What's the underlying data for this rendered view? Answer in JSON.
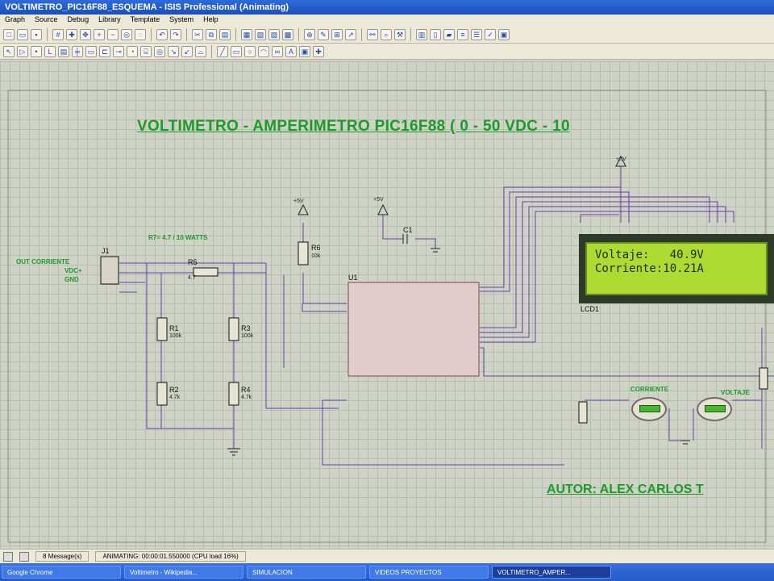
{
  "window": {
    "title": "VOLTIMETRO_PIC16F88_ESQUEMA - ISIS Professional (Animating)"
  },
  "menu": [
    "Graph",
    "Source",
    "Debug",
    "Library",
    "Template",
    "System",
    "Help"
  ],
  "schematic": {
    "title": "VOLTIMETRO - AMPERIMETRO PIC16F88 (  0 - 50 VDC  - 10",
    "author": "AUTOR: ALEX CARLOS T",
    "shunt_note": "R7= 4.7    / 10 WATTS",
    "out_label_1": "OUT  CORRIENTE",
    "out_label_2": "VDC+",
    "out_label_3": "GND",
    "j1": "J1",
    "r_labels": [
      "R1",
      "R2",
      "R3",
      "R4",
      "R5",
      "R6"
    ],
    "r_values": [
      "100k",
      "4.7k",
      "100k",
      "4.7k",
      "4.7",
      "10k"
    ],
    "u1": "U1",
    "c1": "C1",
    "lcd": "LCD1",
    "vplus": "+5V",
    "meter_current": "CORRIENTE",
    "meter_voltage": "VOLTAJE"
  },
  "lcd_display": {
    "line1": "Voltaje:   40.9V",
    "line2": "Corriente:10.21A"
  },
  "status": {
    "messages": "8 Message(s)",
    "animating": "ANIMATING: 00:00:01.550000 (CPU load 16%)"
  },
  "taskbar": [
    "Google Chrome",
    "Voltimetro - Wikipedia...",
    "SIMULACION",
    "VIDEOS PROYECTOS",
    "VOLTIMETRO_AMPER..."
  ]
}
